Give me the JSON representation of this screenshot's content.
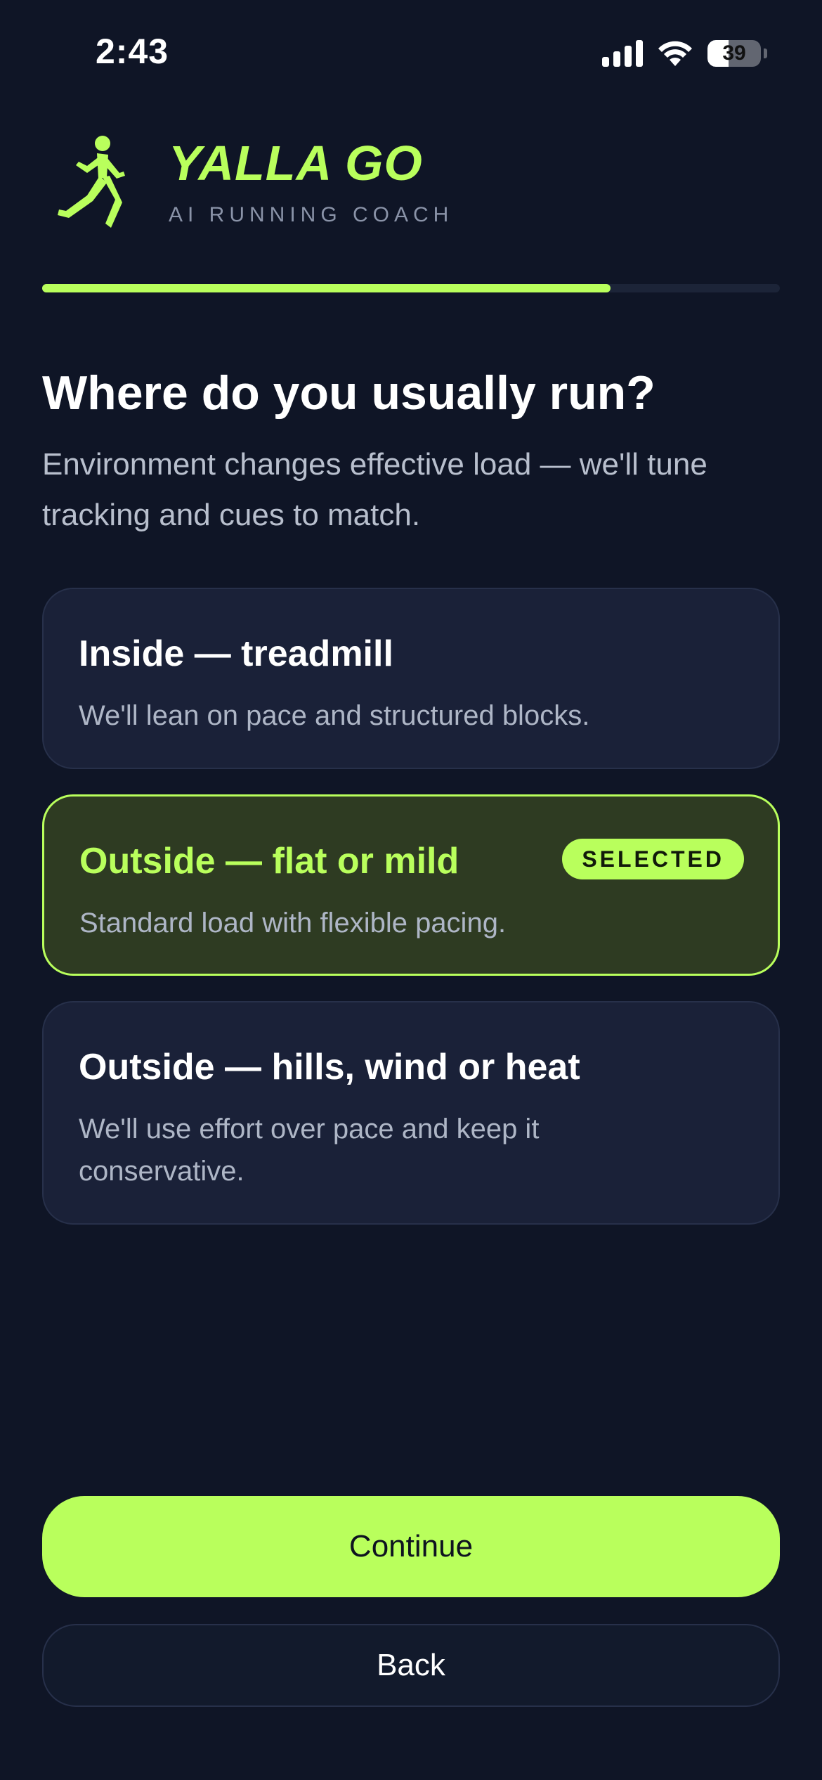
{
  "status_bar": {
    "time": "2:43",
    "battery_level": "39",
    "icons": [
      "signal-icon",
      "wifi-icon",
      "battery-icon"
    ]
  },
  "brand": {
    "name": "YALLA GO",
    "tagline": "AI RUNNING COACH",
    "logo_icon": "runner-icon"
  },
  "progress": {
    "fraction": 0.77
  },
  "question": {
    "title": "Where do you usually run?",
    "subtitle": "Environment changes effective load — we'll tune tracking and cues to match."
  },
  "options": [
    {
      "title": "Inside — treadmill",
      "description": "We'll lean on pace and structured blocks.",
      "selected": false
    },
    {
      "title": "Outside — flat or mild",
      "description": "Standard load with flexible pacing.",
      "selected": true,
      "badge": "SELECTED"
    },
    {
      "title": "Outside — hills, wind or heat",
      "description": "We'll use effort over pace and keep it conservative.",
      "selected": false
    }
  ],
  "actions": {
    "continue_label": "Continue",
    "back_label": "Back"
  },
  "colors": {
    "background": "#0f1526",
    "accent": "#b9ff5c",
    "card": "#1a2138",
    "card_selected": "#2e3b22"
  }
}
